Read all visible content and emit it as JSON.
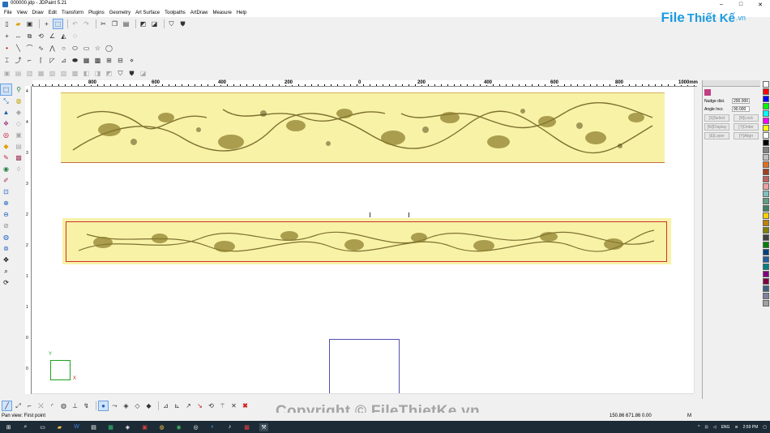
{
  "window": {
    "title": "000000.jdp - JDPaint 5.21",
    "controls": [
      "–",
      "□",
      "✕"
    ]
  },
  "menu": [
    "File",
    "View",
    "Draw",
    "Edit",
    "Transform",
    "Plugins",
    "Geometry",
    "Art Surface",
    "Toolpaths",
    "ArtDraw",
    "Measure",
    "Help"
  ],
  "brand": {
    "file": "File",
    "rest": "Thiết Kế",
    "tld": ".vn"
  },
  "ruler": {
    "labels": [
      "800",
      "600",
      "400",
      "200",
      "0",
      "200",
      "400",
      "600",
      "800",
      "1000mm"
    ]
  },
  "vruler": {
    "labels": [
      "4",
      "4",
      "3",
      "3",
      "2",
      "2",
      "1",
      "1",
      "0",
      "0"
    ]
  },
  "panel": {
    "nudge_label": "Nudge dist.",
    "nudge_value": "200.000",
    "angle_label": "Angle Incr.",
    "angle_value": "90.000",
    "buttons": [
      "[S]Select",
      "[R]Lock",
      "[W]Display",
      "[T]Order",
      "[E]Layer",
      "[Y]Align"
    ]
  },
  "palette": [
    "#ffffff",
    "#ff0000",
    "#0000ff",
    "#00ff00",
    "#00ffff",
    "#ff00ff",
    "#ffff00",
    "#ffffff",
    "#000000",
    "#808080",
    "#c0c0c0",
    "#e07020",
    "#a04020",
    "#c06060",
    "#f0a0a0",
    "#80c0c0",
    "#60a080",
    "#408060",
    "#ffd000",
    "#c08000",
    "#808000",
    "#404040",
    "#008000",
    "#004080",
    "#2060a0",
    "#008080",
    "#800080",
    "#800040",
    "#406080",
    "#8080a0",
    "#a0a0a0"
  ],
  "axis": {
    "y": "Y",
    "x": "X"
  },
  "status": {
    "message": "Pan view: First point",
    "coords": "150.86 671.86 0.00",
    "mode": "M"
  },
  "watermark": "Copyright © FileThietKe.vn",
  "tray": {
    "lang": "ENG",
    "time": "2:59 PM"
  }
}
